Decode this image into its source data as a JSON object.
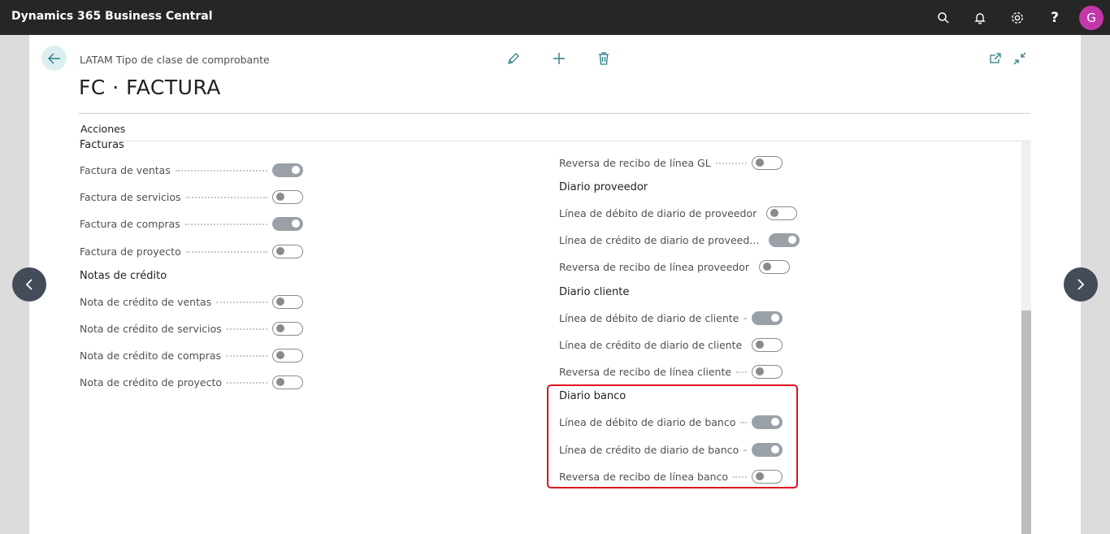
{
  "app": {
    "title": "Dynamics 365 Business Central",
    "user_initial": "G",
    "avatar_color": "#c238a9"
  },
  "topbar_icons": [
    "search-icon",
    "bell-icon",
    "gear-icon",
    "help-icon"
  ],
  "page": {
    "caption": "LATAM Tipo de clase de comprobante",
    "title": "FC · FACTURA",
    "actions_label": "Acciones",
    "help_glyph": "?"
  },
  "groups": {
    "facturas": {
      "title": "Facturas",
      "items": [
        {
          "label": "Factura de ventas",
          "on": true
        },
        {
          "label": "Factura de servicios",
          "on": false
        },
        {
          "label": "Factura de compras",
          "on": true
        },
        {
          "label": "Factura de proyecto",
          "on": false
        }
      ]
    },
    "notas": {
      "title": "Notas de crédito",
      "items": [
        {
          "label": "Nota de crédito de ventas",
          "on": false
        },
        {
          "label": "Nota de crédito de servicios",
          "on": false
        },
        {
          "label": "Nota de crédito de compras",
          "on": false
        },
        {
          "label": "Nota de crédito de proyecto",
          "on": false
        }
      ]
    },
    "gl": {
      "items": [
        {
          "label": "Reversa de recibo de línea GL",
          "on": false
        }
      ]
    },
    "proveedor": {
      "title": "Diario proveedor",
      "items": [
        {
          "label": "Línea de débito de diario de proveedor",
          "on": false
        },
        {
          "label": "Línea de crédito de diario de proveed...",
          "on": true
        },
        {
          "label": "Reversa de recibo de línea proveedor",
          "on": false
        }
      ]
    },
    "cliente": {
      "title": "Diario cliente",
      "items": [
        {
          "label": "Línea de débito de diario de cliente",
          "on": true
        },
        {
          "label": "Línea de crédito de diario de cliente",
          "on": false
        },
        {
          "label": "Reversa de recibo de línea cliente",
          "on": false
        }
      ]
    },
    "banco": {
      "title": "Diario banco",
      "items": [
        {
          "label": "Línea de débito de diario de banco",
          "on": true
        },
        {
          "label": "Línea de crédito de diario de banco",
          "on": true
        },
        {
          "label": "Reversa de recibo de línea banco",
          "on": false
        }
      ]
    }
  }
}
